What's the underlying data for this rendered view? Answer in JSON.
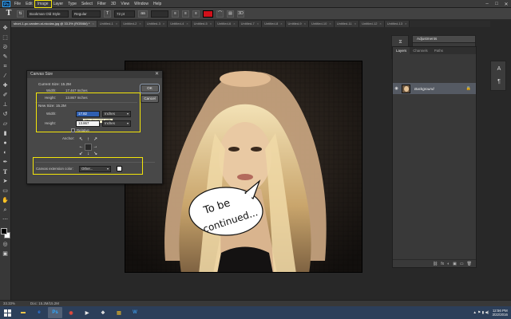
{
  "menubar": {
    "logo": "Ps",
    "items": [
      "File",
      "Edit",
      "Image",
      "Layer",
      "Type",
      "Select",
      "Filter",
      "3D",
      "View",
      "Window",
      "Help"
    ],
    "window_controls": [
      "–",
      "□",
      "✕"
    ]
  },
  "options": {
    "tool_glyph": "T",
    "font_family": "Bookman Old Style",
    "font_style": "Regular",
    "font_size": "72 pt",
    "antialias": "aa",
    "text_color": "#d0101a"
  },
  "tabs": [
    {
      "label": "short-1-pc-vanden-st-nicolas.jpg @ 33.3% (RGB/8#) *",
      "active": true
    },
    {
      "label": "Untitled-1",
      "active": false
    },
    {
      "label": "Untitled-2",
      "active": false
    },
    {
      "label": "Untitled-3",
      "active": false
    },
    {
      "label": "Untitled-4",
      "active": false
    },
    {
      "label": "Untitled-5",
      "active": false
    },
    {
      "label": "Untitled-6",
      "active": false
    },
    {
      "label": "Untitled-7",
      "active": false
    },
    {
      "label": "Untitled-8",
      "active": false
    },
    {
      "label": "Untitled-9",
      "active": false
    },
    {
      "label": "Untitled-10",
      "active": false
    },
    {
      "label": "Untitled-11",
      "active": false
    },
    {
      "label": "Untitled-12",
      "active": false
    },
    {
      "label": "Untitled-13",
      "active": false
    }
  ],
  "dialog": {
    "title": "Canvas Size",
    "close": "✕",
    "current_size_label": "Current Size: 15.2M",
    "current_width_label": "Width:",
    "current_width_value": "17.467 Inches",
    "current_height_label": "Height:",
    "current_height_value": "13.867 Inches",
    "new_size_label": "New Size: 15.2M",
    "width_label": "Width:",
    "width_value": "17.82",
    "width_unit": "Inches",
    "height_label": "Height:",
    "height_value": "13.867",
    "height_unit": "Inches",
    "tooltip": "New document width",
    "relative_label": "Relative",
    "anchor_label": "Anchor:",
    "extension_label": "Canvas extension color:",
    "extension_value": "Other...",
    "ok": "OK",
    "cancel": "Cancel"
  },
  "speech_bubble": {
    "line1": "To be",
    "line2": "continued..."
  },
  "panels": {
    "adjustments_tab": "Adjustments",
    "layer_tabs": [
      "Layers",
      "Channels",
      "Paths"
    ],
    "layer_name": "Background",
    "footer_icons": [
      "⛓",
      "fx",
      "◐",
      "▣",
      "▭",
      "🗑"
    ]
  },
  "statusbar": {
    "zoom": "33.33%",
    "doc": "Doc: 15.2M/15.2M"
  },
  "taskbar": {
    "clock_time": "12:56 PM",
    "clock_date": "3/22/2016",
    "tray_icons": "▲ ⚑ ▮ ◀)"
  }
}
